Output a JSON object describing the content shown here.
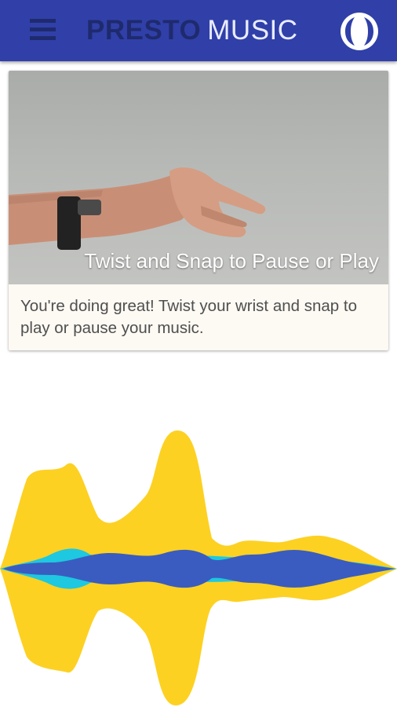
{
  "appbar": {
    "title_brand": "PRESTO",
    "title_product": "MUSIC",
    "menu_icon": "hamburger-menu-icon",
    "connect_icon": "band-connection-icon",
    "background_color": "#3040a8"
  },
  "tutorial_card": {
    "image_caption": "Twist and Snap to Pause or Play",
    "body_text": "You're doing great! Twist your wrist and snap to play or pause your music.",
    "image_subject": "hand-snap-photo"
  },
  "waveform": {
    "colors": {
      "outer": "#fdd122",
      "middle": "#1ec8e0",
      "inner": "#3a5cc0"
    }
  }
}
